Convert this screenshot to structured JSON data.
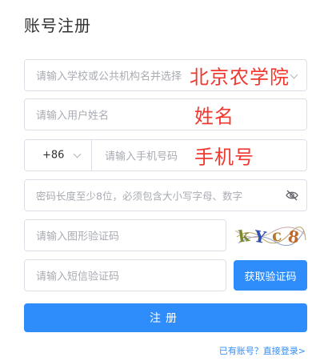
{
  "page_title": "账号注册",
  "school": {
    "placeholder": "请输入学校或公共机构名并选择",
    "overlay": "北京农学院"
  },
  "name": {
    "placeholder": "请输入用户姓名",
    "overlay": "姓名"
  },
  "phone": {
    "prefix": "+86",
    "placeholder": "请输入手机号码",
    "overlay": "手机号"
  },
  "password": {
    "placeholder": "密码长度至少8位，必须包含大小写字母、数字"
  },
  "captcha": {
    "placeholder": "请输入图形验证码",
    "code": "kYc8"
  },
  "sms": {
    "placeholder": "请输入短信验证码",
    "button": "获取验证码"
  },
  "submit_label": "注册",
  "login_link": "已有账号？直接登录>",
  "colors": {
    "primary": "#2f8dfb",
    "annotation": "#f0382f",
    "border": "#dcdfe6",
    "placeholder": "#a8abb2"
  }
}
